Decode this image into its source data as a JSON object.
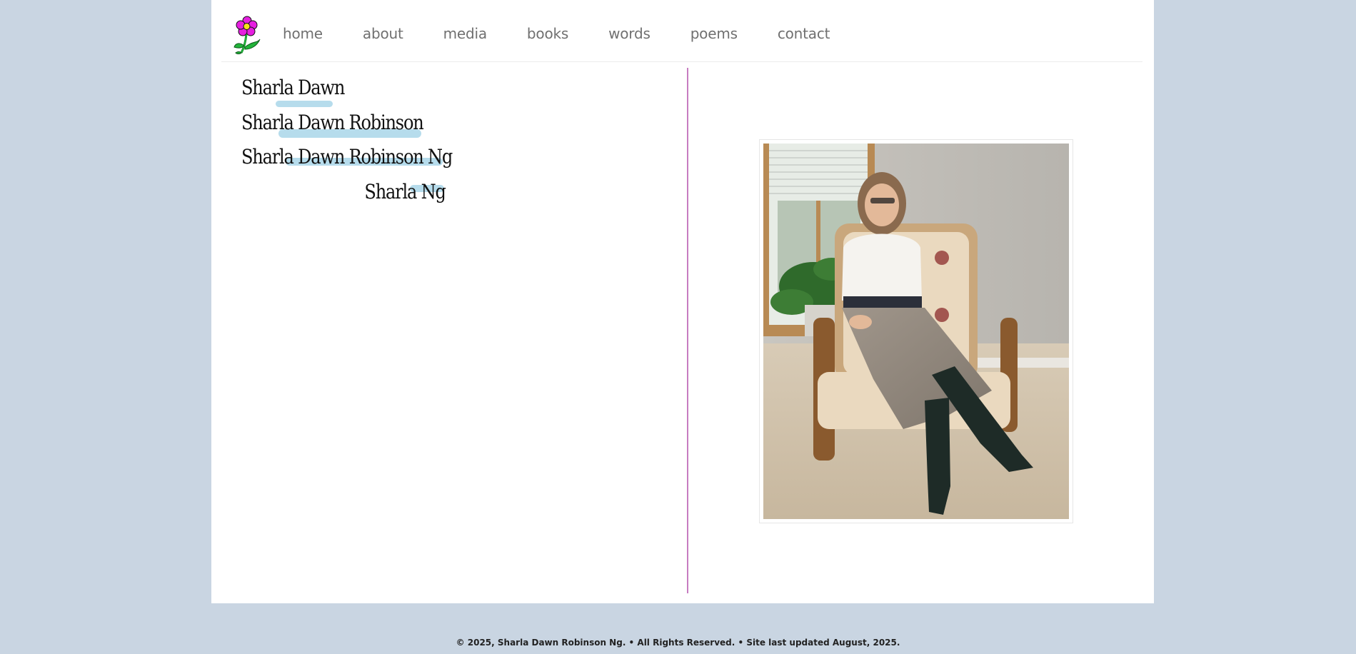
{
  "nav": {
    "items": [
      {
        "label": "home"
      },
      {
        "label": "about"
      },
      {
        "label": "media"
      },
      {
        "label": "books"
      },
      {
        "label": "words"
      },
      {
        "label": "poems"
      },
      {
        "label": "contact"
      }
    ]
  },
  "names": {
    "line1": "Sharla  Dawn",
    "line2": "Sharla  Dawn Robinson",
    "line3": "Sharla  Dawn Robinson Ng",
    "line4": "Sharla Ng"
  },
  "footer": {
    "text": "© 2025, Sharla Dawn Robinson Ng. • All Rights Reserved. • Site last updated August, 2025."
  },
  "colors": {
    "background": "#c9d5e2",
    "divider": "#c77cc1",
    "nav_text": "#707070",
    "splash": "#aed8ea",
    "flower_petals": "#e61fe0",
    "flower_stem": "#22b43a"
  },
  "icons": {
    "logo": "flower-icon"
  }
}
